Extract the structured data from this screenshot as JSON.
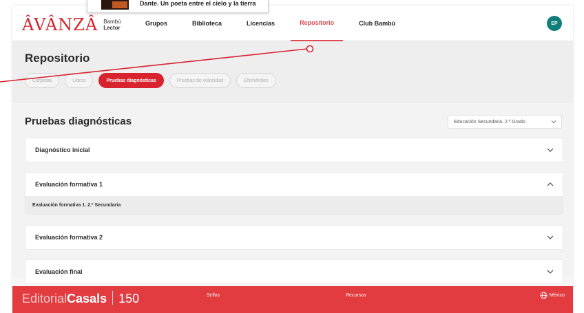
{
  "popup": {
    "text": "Dante. Un poeta entre el cielo y la tierra"
  },
  "header": {
    "logo_word": "ÂVÂNZÂ",
    "logo_sub_1": "Bambú",
    "logo_sub_2": "Lector",
    "nav": [
      {
        "label": "Grupos",
        "active": false
      },
      {
        "label": "Biblioteca",
        "active": false
      },
      {
        "label": "Licencias",
        "active": false
      },
      {
        "label": "Repositorio",
        "active": true
      },
      {
        "label": "Club Bambú",
        "active": false
      }
    ],
    "avatar_initials": "EP",
    "avatar_color": "#0f7f7a",
    "accent_color": "#d8222e"
  },
  "page": {
    "title": "Repositorio",
    "chips": [
      {
        "label": "Carpetas",
        "active": false
      },
      {
        "label": "Libros",
        "active": false
      },
      {
        "label": "Pruebas diagnósticas",
        "active": true
      },
      {
        "label": "Pruebas de velocidad",
        "active": false
      },
      {
        "label": "Efemérides",
        "active": false
      }
    ]
  },
  "section": {
    "title": "Pruebas diagnósticas",
    "grade_select": "Educación Secundaria. 2.º Grado",
    "accordions": [
      {
        "label": "Diagnóstico inicial",
        "expanded": false,
        "icon": "chevron-down-icon"
      },
      {
        "label": "Evaluación formativa 1",
        "expanded": true,
        "icon": "chevron-up-icon",
        "content": "Evaluación formativa 1. 2.º Secundaria"
      },
      {
        "label": "Evaluación formativa 2",
        "expanded": false,
        "icon": "chevron-down-icon"
      },
      {
        "label": "Evaluación final",
        "expanded": false,
        "icon": "chevron-down-icon"
      }
    ]
  },
  "footer": {
    "brand_light": "Editorial",
    "brand_bold": "Casals",
    "brand_number": "150",
    "sellos": "Sellos",
    "recursos": "Recursos",
    "country": "México",
    "background_color": "#e23b40"
  }
}
